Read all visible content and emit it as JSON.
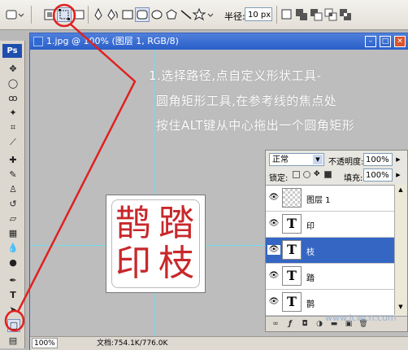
{
  "options_bar": {
    "radius_label": "半径:",
    "radius_value": "10 px"
  },
  "toolbox": {
    "logo": "Ps",
    "selected_tool": "rounded-rectangle-tool"
  },
  "document": {
    "title": "1.jpg @ 100% (图层 1, RGB/8)",
    "seal_chars": [
      "鹊",
      "踏",
      "印",
      "枝"
    ],
    "zoom": "100%",
    "doc_info": "文档:754.1K/776.0K"
  },
  "annotation": {
    "lines": [
      "1.选择路径,点自定义形状工具-",
      "圆角矩形工具,在参考线的焦点处",
      "按住ALT键从中心拖出一个圆角矩形"
    ]
  },
  "layers_panel": {
    "blend_mode": "正常",
    "opacity_label": "不透明度:",
    "opacity_value": "100%",
    "lock_label": "锁定:",
    "fill_label": "填充:",
    "fill_value": "100%",
    "layers": [
      {
        "name": "图层 1",
        "thumb": "",
        "selected": false
      },
      {
        "name": "印",
        "thumb": "T",
        "selected": false
      },
      {
        "name": "枝",
        "thumb": "T",
        "selected": true
      },
      {
        "name": "踏",
        "thumb": "T",
        "selected": false
      },
      {
        "name": "鹊",
        "thumb": "T",
        "selected": false
      }
    ]
  },
  "watermark": "www.jcwcn.com",
  "colors": {
    "annotation_red": "#e02020",
    "seal_red": "#c8282b",
    "guide": "#6ee0ef",
    "selection_blue": "#3566c4"
  }
}
